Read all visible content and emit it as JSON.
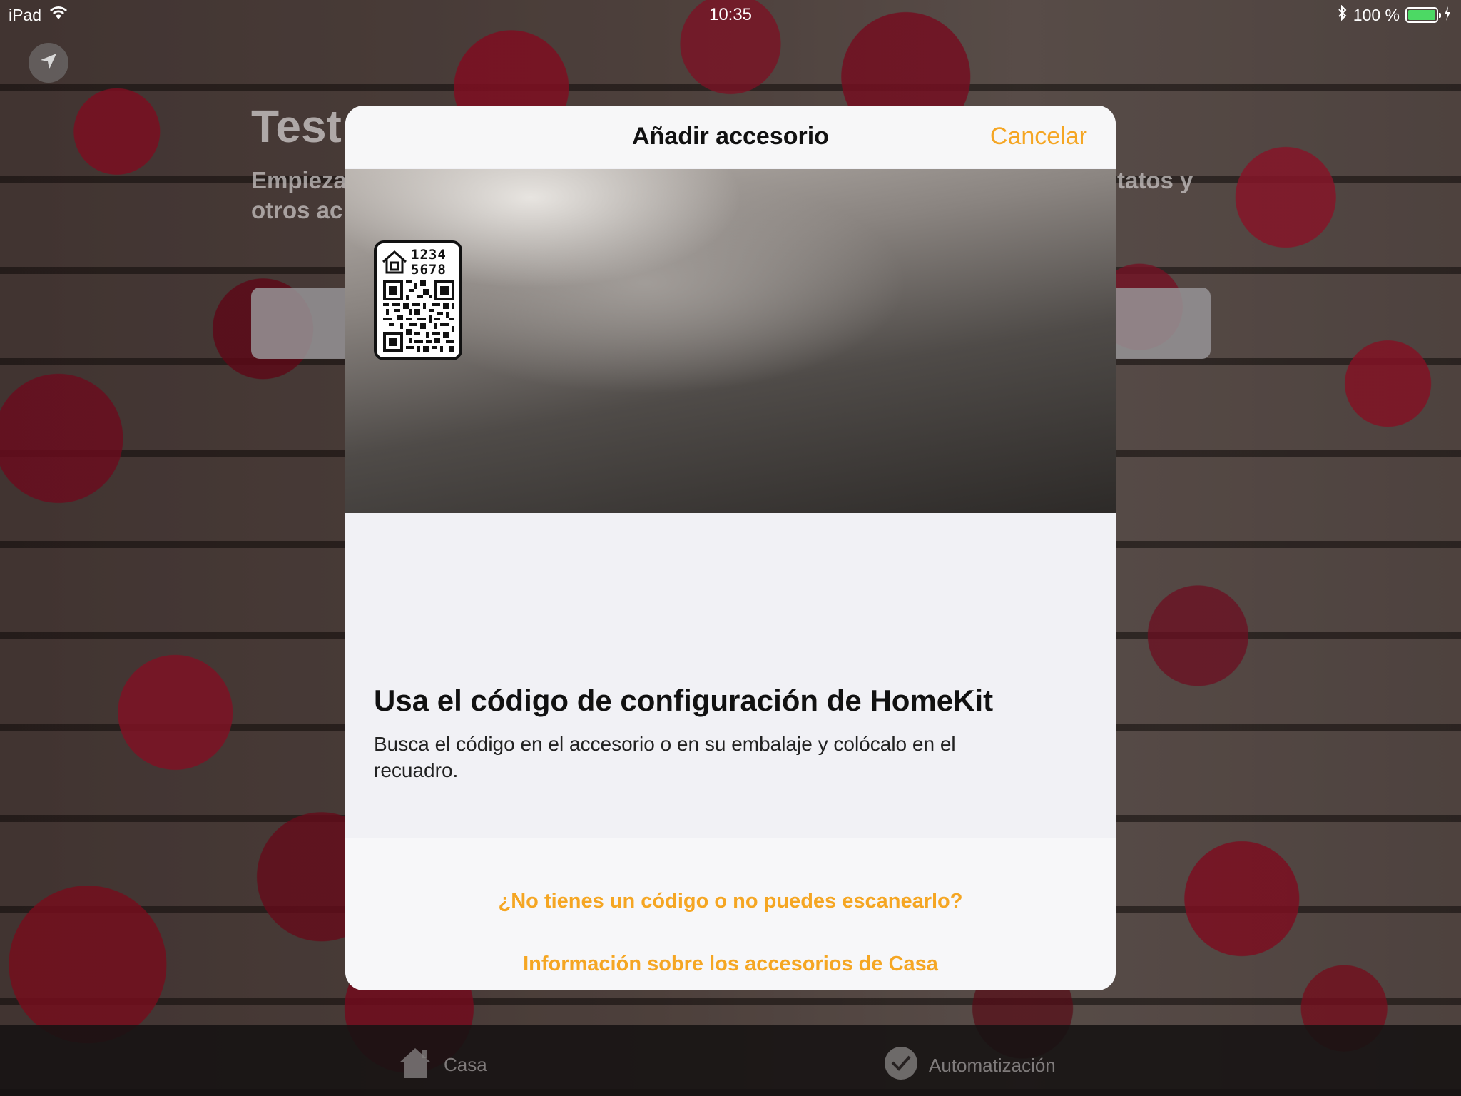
{
  "status_bar": {
    "device": "iPad",
    "time": "10:35",
    "battery_percent": "100 %",
    "battery_level": 1.0,
    "battery_color": "#4cd964"
  },
  "background_page": {
    "title_fragment": "Test",
    "subtitle_left_line1": "Empieza",
    "subtitle_left_line2": "otros ac",
    "subtitle_right_fragment": "tatos y"
  },
  "modal": {
    "title": "Añadir accesorio",
    "cancel_label": "Cancelar",
    "code_digits_line1": "1234",
    "code_digits_line2": "5678",
    "heading": "Usa el código de configuración de HomeKit",
    "body": "Busca el código en el accesorio o en su embalaje y colócalo en el recuadro.",
    "link_no_code": "¿No tienes un código o no puedes escanearlo?",
    "link_info": "Información sobre los accesorios de Casa"
  },
  "tab_bar": {
    "tabs": [
      {
        "label": "Casa",
        "icon": "house-icon"
      },
      {
        "label": "Automatización",
        "icon": "clock-check-icon"
      }
    ]
  },
  "colors": {
    "accent": "#f5a623",
    "modal_background": "#f1f1f5"
  }
}
